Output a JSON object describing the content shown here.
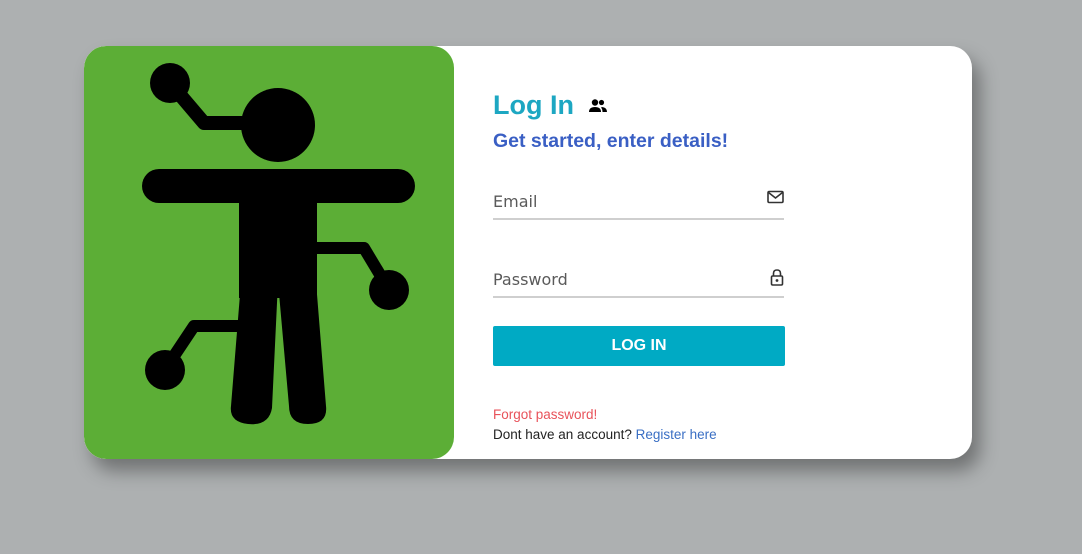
{
  "login": {
    "title": "Log In",
    "title_icon": "users-icon",
    "subtitle": "Get started, enter details!",
    "email": {
      "placeholder": "Email",
      "value": "",
      "icon": "mail-icon"
    },
    "password": {
      "placeholder": "Password",
      "value": "",
      "icon": "lock-icon"
    },
    "submit_label": "LOG IN",
    "forgot_label": "Forgot password!",
    "register_prompt": "Dont have an account?",
    "register_link": "Register here"
  },
  "illustration": {
    "icon": "cyborg-figure-icon"
  },
  "colors": {
    "background": "#adb0b1",
    "card": "#ffffff",
    "illustration_bg": "#5cae36",
    "title": "#1da7c2",
    "subtitle": "#3a5fc4",
    "button": "#00aac4",
    "forgot": "#e8525a",
    "link": "#3a6fc4"
  }
}
